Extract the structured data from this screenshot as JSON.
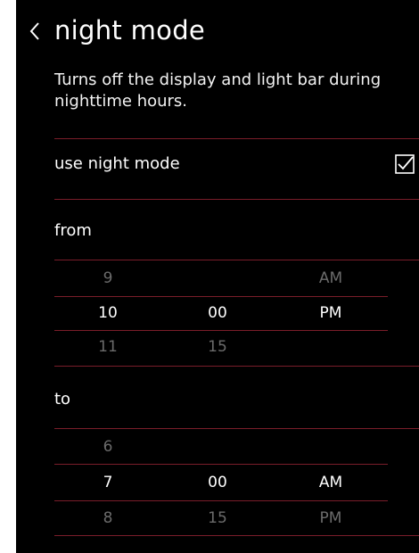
{
  "header": {
    "back_icon": "chevron-left-icon",
    "title": "night mode"
  },
  "description": "Turns off the display and light bar during nighttime hours.",
  "use_night_mode": {
    "label": "use night mode",
    "checked": true,
    "icon": "checkbox-checked-icon"
  },
  "from": {
    "label": "from",
    "rows": [
      {
        "hour": "9",
        "minute": "",
        "ampm": "AM"
      },
      {
        "hour": "10",
        "minute": "00",
        "ampm": "PM"
      },
      {
        "hour": "11",
        "minute": "15",
        "ampm": ""
      }
    ],
    "selected_index": 1
  },
  "to": {
    "label": "to",
    "rows": [
      {
        "hour": "6",
        "minute": "",
        "ampm": ""
      },
      {
        "hour": "7",
        "minute": "00",
        "ampm": "AM"
      },
      {
        "hour": "8",
        "minute": "15",
        "ampm": "PM"
      }
    ],
    "selected_index": 1
  },
  "colors": {
    "background": "#000000",
    "divider": "#7a1d2a",
    "text_selected": "#ffffff",
    "text_dim": "#6b6b6b"
  }
}
